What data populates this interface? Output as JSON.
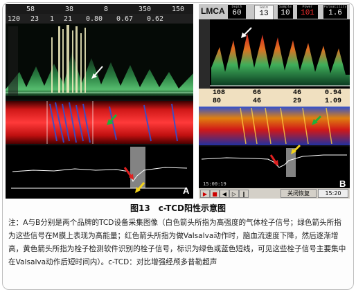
{
  "panelA": {
    "letter": "A",
    "header_row1": [
      "58",
      "38",
      "8",
      "350",
      "150"
    ],
    "header_row2": [
      "120",
      "23",
      "1",
      "21",
      "0.80",
      "0.67",
      "0.62"
    ]
  },
  "panelB": {
    "letter": "B",
    "logo": "LMCA",
    "readout_labels": [
      "Depth",
      "Gain",
      "Sample",
      "Power",
      "Pulsatility"
    ],
    "readout_values": [
      "60",
      "13",
      "10",
      "101",
      "1.6"
    ],
    "stats_row1": [
      "108",
      "66",
      "46",
      "0.94"
    ],
    "stats_row2": [
      "80",
      "46",
      "29",
      "1.09"
    ],
    "timestamp": "15:00:19",
    "toolbar_label": "关闭恢复",
    "toolbar_time": "15:20"
  },
  "caption": {
    "title": "图13　c-TCD阳性示意图",
    "note": "注：A与B分别是两个品牌的TCD设备采集图像（白色箭头所指为高强度的气体栓子信号；绿色箭头所指为这些信号在M膜上表现为高能量；红色箭头所指为做Valsalva动作时，脑血流速度下降，然后逐渐增高，黄色箭头所指为栓子检测软件识别的栓子信号，标识为绿色或蓝色短线，可见这些栓子信号主要集中在Valsalva动作后短时间内）。c-TCD：对比增强经颅多普勒超声"
  },
  "colors": {
    "arrow_white": "#ffffff",
    "arrow_green": "#1fb03a",
    "arrow_red": "#e02020",
    "arrow_yellow": "#f2d21b",
    "spectrum_green": "#3fae5a",
    "mmode_red": "#d01818",
    "mmode_blue": "#3050d0",
    "mmode_orange": "#e08010"
  }
}
